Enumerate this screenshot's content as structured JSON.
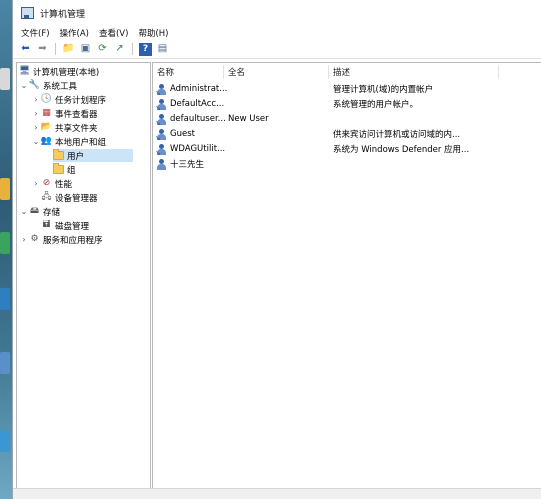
{
  "window": {
    "title": "计算机管理"
  },
  "menu": [
    "文件(F)",
    "操作(A)",
    "查看(V)",
    "帮助(H)"
  ],
  "toolbar": [
    "back-arrow",
    "forward-arrow",
    "up-folder",
    "show-hide-tree",
    "refresh",
    "export-list",
    "help",
    "properties"
  ],
  "tree": {
    "root": "计算机管理(本地)",
    "system_tools": "系统工具",
    "task_scheduler": "任务计划程序",
    "event_viewer": "事件查看器",
    "shared_folders": "共享文件夹",
    "local_users_groups": "本地用户和组",
    "users": "用户",
    "groups": "组",
    "performance": "性能",
    "device_manager": "设备管理器",
    "storage": "存储",
    "disk_management": "磁盘管理",
    "services_apps": "服务和应用程序"
  },
  "list": {
    "headers": {
      "name": "名称",
      "fullname": "全名",
      "description": "描述"
    },
    "rows": [
      {
        "name": "Administrat...",
        "fullname": "",
        "description": "管理计算机(域)的内置帐户"
      },
      {
        "name": "DefaultAcc...",
        "fullname": "",
        "description": "系统管理的用户帐户。"
      },
      {
        "name": "defaultuser...",
        "fullname": "New User",
        "description": ""
      },
      {
        "name": "Guest",
        "fullname": "",
        "description": "供来宾访问计算机或访问域的内..."
      },
      {
        "name": "WDAGUtilit...",
        "fullname": "",
        "description": "系统为 Windows Defender 应用..."
      },
      {
        "name": "十三先生",
        "fullname": "",
        "description": ""
      }
    ]
  }
}
